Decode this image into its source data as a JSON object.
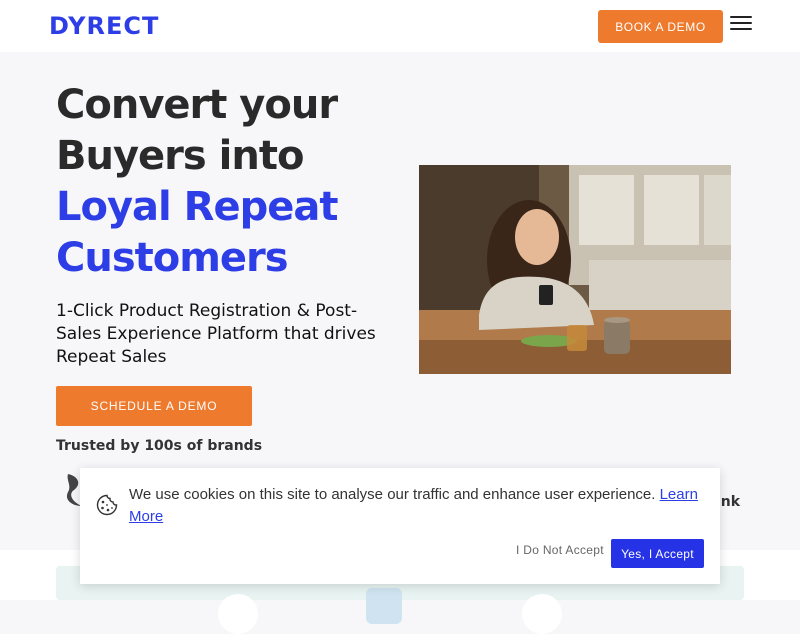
{
  "header": {
    "logo_text": "DYRECT",
    "book_demo_label": "BOOK A DEMO"
  },
  "hero": {
    "title_line1": "Convert your",
    "title_line2": "Buyers into",
    "title_line3": "Loyal Repeat",
    "title_line4": "Customers",
    "subhead": "1-Click Product Registration & Post-Sales Experience Platform that drives Repeat Sales",
    "schedule_demo_label": "SCHEDULE A DEMO",
    "trusted_text": "Trusted by 100s of brands",
    "brand_partial_text": "ink"
  },
  "cookie_banner": {
    "message": "We use cookies on this site to analyse our traffic and enhance user experience.",
    "learn_more_label": "Learn More",
    "decline_label": "I Do Not Accept",
    "accept_label": "Yes, I Accept"
  },
  "colors": {
    "brand_blue": "#2d3ee6",
    "accent_orange": "#ee7a2e",
    "accept_blue": "#2532e6"
  },
  "icons": {
    "menu": "hamburger-menu-icon",
    "cookie": "cookie-icon"
  }
}
